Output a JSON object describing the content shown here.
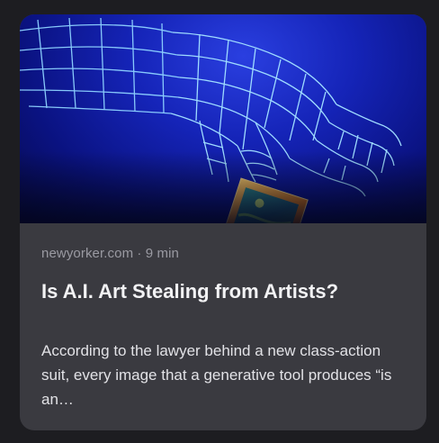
{
  "article": {
    "source": "newyorker.com",
    "separator": "·",
    "read_time": "9 min",
    "meta_line": "newyorker.com · 9 min",
    "title": "Is A.I. Art Stealing from Artists?",
    "snippet": "According to the lawyer behind a new class-action suit, every image that a generative tool produces “is an…"
  },
  "colors": {
    "card_background": "#3a3a40",
    "page_background": "#1d1d21",
    "hero_blue": "#1524b8",
    "wireframe": "#8fd3ff",
    "frame_gold": "#e0902c",
    "meta_text": "#9a9aa2",
    "title_text": "#f2f2f4"
  },
  "hero_image": {
    "icon": "wireframe-hand-holding-painting-illustration"
  }
}
